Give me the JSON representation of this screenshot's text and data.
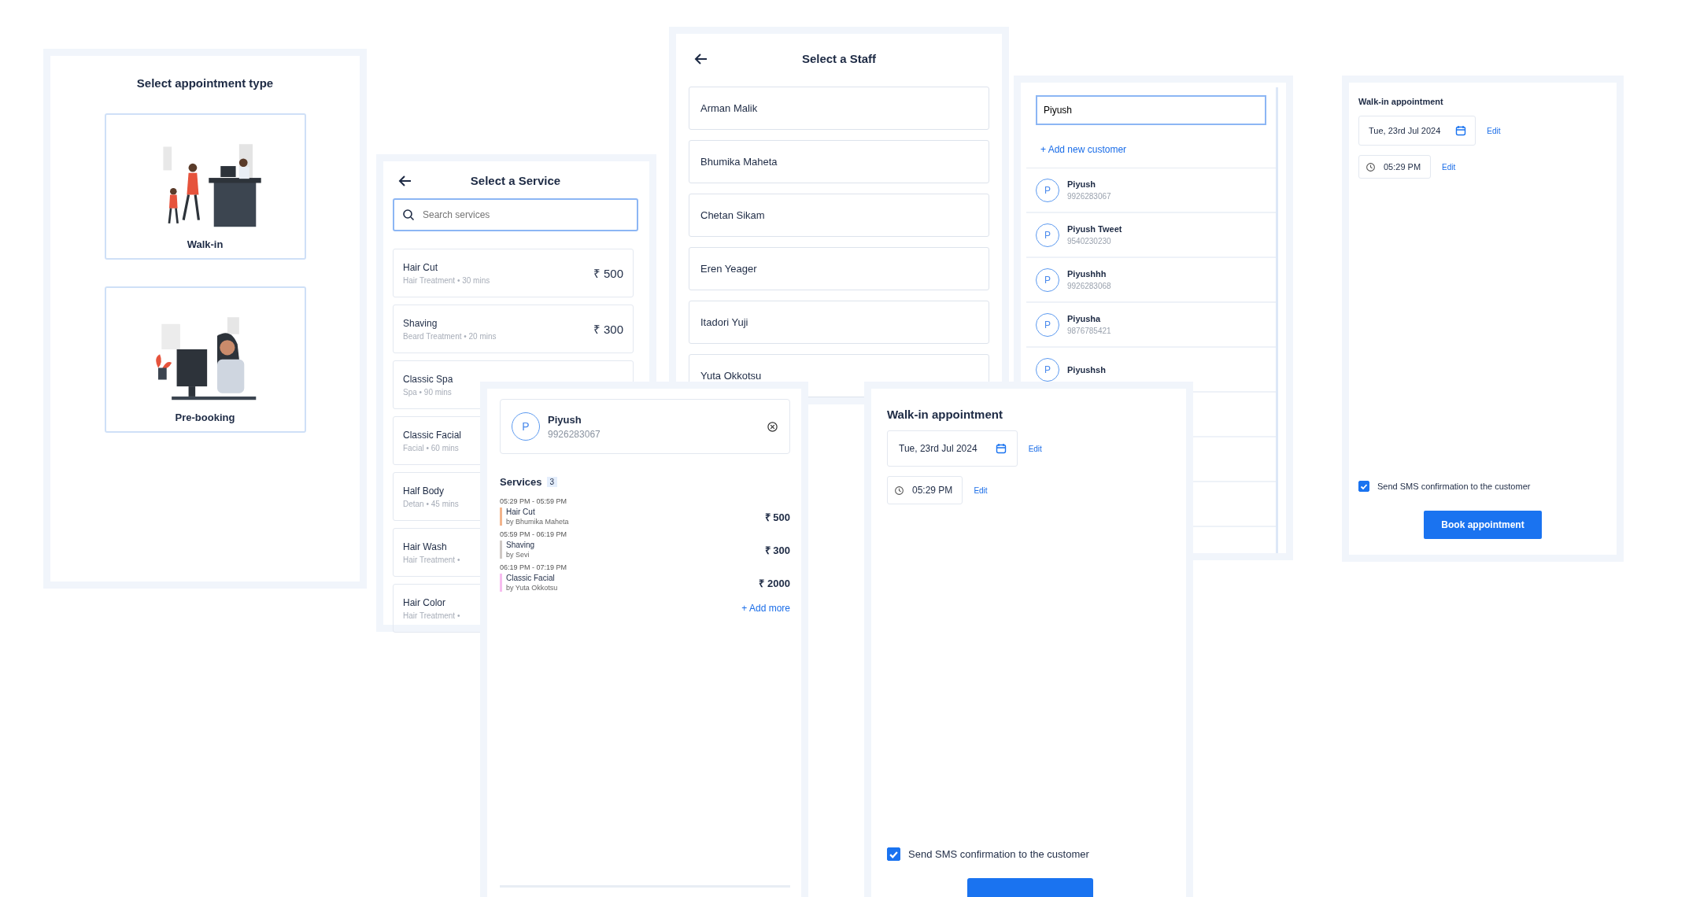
{
  "type_panel": {
    "title": "Select appointment type",
    "options": [
      {
        "kind": "walk-in",
        "label": "Walk-in"
      },
      {
        "kind": "pre-booking",
        "label": "Pre-booking"
      }
    ]
  },
  "service_panel": {
    "title": "Select a Service",
    "search": {
      "placeholder": "Search services"
    },
    "services": [
      {
        "name": "Hair Cut",
        "detail": "Hair Treatment • 30 mins",
        "price": "₹ 500"
      },
      {
        "name": "Shaving",
        "detail": "Beard Treatment • 20 mins",
        "price": "₹ 300"
      },
      {
        "name": "Classic Spa",
        "detail": "Spa • 90 mins"
      },
      {
        "name": "Classic Facial",
        "detail": "Facial • 60 mins"
      },
      {
        "name": "Half Body",
        "detail": "Detan • 45 mins"
      },
      {
        "name": "Hair Wash",
        "detail": "Hair Treatment •"
      },
      {
        "name": "Hair Color",
        "detail": "Hair Treatment •"
      }
    ]
  },
  "staff_panel": {
    "title": "Select a Staff",
    "staff": [
      "Arman Malik",
      "Bhumika Maheta",
      "Chetan Sikam",
      "Eren Yeager",
      "Itadori Yuji",
      "Yuta Okkotsu"
    ]
  },
  "customer_panel": {
    "search": {
      "value": "Piyush"
    },
    "add_link": "+ Add new customer",
    "customers": [
      {
        "initial": "P",
        "name": "Piyush",
        "phone": "9926283067"
      },
      {
        "initial": "P",
        "name": "Piyush Tweet",
        "phone": "9540230230"
      },
      {
        "initial": "P",
        "name": "Piyushhh",
        "phone": "9926283068"
      },
      {
        "initial": "P",
        "name": "Piyusha",
        "phone": "9876785421"
      },
      {
        "initial": "P",
        "name": "Piyushsh"
      }
    ]
  },
  "booking_panel": {
    "title": "Walk-in appointment",
    "date": "Tue, 23rd Jul 2024",
    "date_edit": "Edit",
    "time": "05:29 PM",
    "time_edit": "Edit",
    "sms": {
      "label": "Send SMS confirmation to the customer",
      "checked": true
    },
    "button": "Book appointment"
  },
  "summary_panel": {
    "customer": {
      "initial": "P",
      "name": "Piyush",
      "phone": "9926283067"
    },
    "services_heading": "Services",
    "services_count": "3",
    "services": [
      {
        "time": "05:29 PM - 05:59 PM",
        "name": "Hair Cut",
        "staff": "by Bhumika Maheta",
        "price": "₹ 500",
        "color": "#f2b48c"
      },
      {
        "time": "05:59 PM - 06:19 PM",
        "name": "Shaving",
        "staff": "by Sevi",
        "price": "₹ 300",
        "color": "#cfc8c4"
      },
      {
        "time": "06:19 PM - 07:19 PM",
        "name": "Classic Facial",
        "staff": "by Yuta Okkotsu",
        "price": "₹ 2000",
        "color": "#f7bdf0"
      }
    ],
    "add_more": "+ Add more"
  },
  "booking_panel_lower": {
    "title": "Walk-in appointment",
    "date": "Tue, 23rd Jul 2024",
    "date_edit": "Edit",
    "time": "05:29 PM",
    "time_edit": "Edit",
    "sms": {
      "label": "Send SMS confirmation to the customer",
      "checked": true
    }
  }
}
